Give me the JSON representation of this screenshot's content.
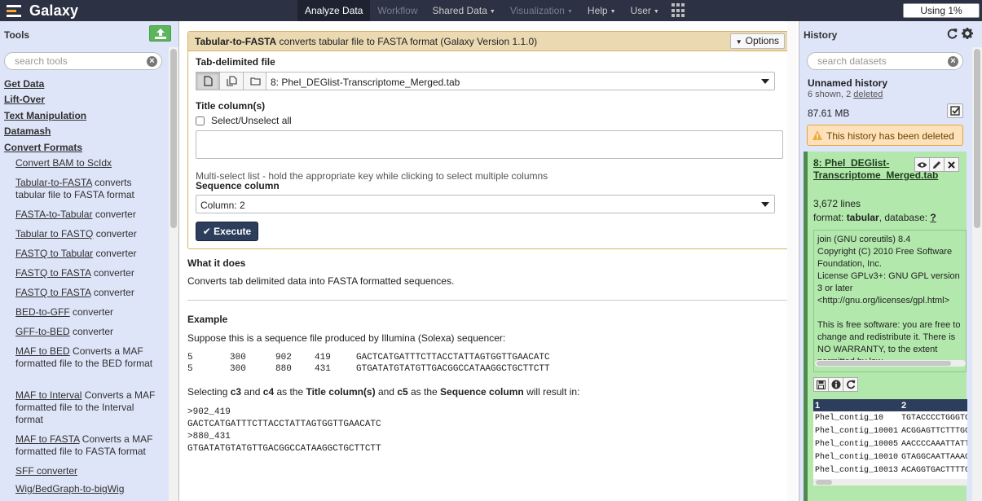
{
  "masthead": {
    "brand": "Galaxy",
    "nav": [
      {
        "label": "Analyze Data",
        "state": "active",
        "caret": false
      },
      {
        "label": "Workflow",
        "state": "disabled",
        "caret": false
      },
      {
        "label": "Shared Data",
        "state": "normal",
        "caret": true
      },
      {
        "label": "Visualization",
        "state": "disabled",
        "caret": true
      },
      {
        "label": "Help",
        "state": "normal",
        "caret": true
      },
      {
        "label": "User",
        "state": "normal",
        "caret": true
      }
    ],
    "usage": "Using 1%"
  },
  "tools_panel": {
    "title": "Tools",
    "search_placeholder": "search tools",
    "sections": [
      "Get Data",
      "Lift-Over",
      "Text Manipulation",
      "Datamash",
      "Convert Formats"
    ],
    "tools": [
      {
        "name": "Convert BAM to ScIdx",
        "desc": ""
      },
      {
        "name": "Tabular-to-FASTA",
        "desc": " converts tabular file to FASTA format"
      },
      {
        "name": "FASTA-to-Tabular",
        "desc": " converter"
      },
      {
        "name": "Tabular to FASTQ",
        "desc": " converter"
      },
      {
        "name": "FASTQ to Tabular",
        "desc": " converter"
      },
      {
        "name": "FASTQ to FASTA",
        "desc": " converter"
      },
      {
        "name": "FASTQ to FASTA",
        "desc": " converter"
      },
      {
        "name": "BED-to-GFF",
        "desc": " converter"
      },
      {
        "name": "GFF-to-BED",
        "desc": " converter"
      },
      {
        "name": "MAF to BED",
        "desc": " Converts a MAF formatted file to the BED format"
      },
      {
        "name": "MAF to Interval",
        "desc": " Converts a MAF formatted file to the Interval format"
      },
      {
        "name": "MAF to FASTA",
        "desc": " Converts a MAF formatted file to FASTA format"
      },
      {
        "name": "SFF converter",
        "desc": ""
      },
      {
        "name": "Wig/BedGraph-to-bigWig",
        "desc": ""
      }
    ]
  },
  "tool_form": {
    "title_bold": "Tabular-to-FASTA",
    "title_rest": " converts tabular file to FASTA format (Galaxy Version 1.1.0)",
    "options_label": "Options",
    "input_label": "Tab-delimited file",
    "input_value": "8: Phel_DEGlist-Transcriptome_Merged.tab",
    "title_cols_label": "Title column(s)",
    "select_all_label": "Select/Unselect all",
    "multi_help": "Multi-select list - hold the appropriate key while clicking to select multiple columns",
    "seq_col_label": "Sequence column",
    "seq_col_value": "Column: 2",
    "execute_label": "Execute"
  },
  "help": {
    "what_heading": "What it does",
    "what_text": "Converts tab delimited data into FASTA formatted sequences.",
    "example_heading": "Example",
    "example_intro": "Suppose this is a sequence file produced by Illumina (Solexa) sequencer:",
    "example_rows": [
      [
        "5",
        "300",
        "902",
        "419",
        "GACTCATGATTTCTTACCTATTAGTGGTTGAACATC"
      ],
      [
        "5",
        "300",
        "880",
        "431",
        "GTGATATGTATGTTGACGGCCATAAGGCTGCTTCTT"
      ]
    ],
    "result_parts": [
      "Selecting ",
      "c3",
      " and ",
      "c4",
      " as the ",
      "Title column(s)",
      " and ",
      "c5",
      " as the ",
      "Sequence column",
      " will result in:"
    ],
    "result_lines": [
      ">902_419",
      "GACTCATGATTTCTTACCTATTAGTGGTTGAACATC",
      ">880_431",
      "GTGATATGTATGTTGACGGCCATAAGGCTGCTTCTT"
    ]
  },
  "history_panel": {
    "title": "History",
    "search_placeholder": "search datasets",
    "name": "Unnamed history",
    "shown_text": "6 shown, 2 ",
    "deleted_link": "deleted",
    "size": "87.61 MB",
    "warning": "This history has been deleted",
    "dataset": {
      "title": "8: Phel_DEGlist-Transcriptome_Merged.tab",
      "lines": "3,672 lines",
      "format_label": "format: ",
      "format_value": "tabular",
      "db_label": ", database: ",
      "db_value": "?",
      "info": "join (GNU coreutils) 8.4\nCopyright (C) 2010 Free Software Foundation, Inc.\nLicense GPLv3+: GNU GPL version 3 or later <http://gnu.org/licenses/gpl.html>\n\nThis is free software: you are free to change and redistribute it. There is NO WARRANTY, to the extent permitted by law.",
      "peek_headers": [
        "1",
        "2"
      ],
      "peek_rows": [
        [
          "Phel_contig_10",
          "TGTACCCCTGGGTGGAC"
        ],
        [
          "Phel_contig_10001",
          "ACGGAGTTCTTTGCCCC"
        ],
        [
          "Phel_contig_10005",
          "AACCCCAAATTATTTAA"
        ],
        [
          "Phel_contig_10010",
          "GTAGGCAATTAAACCAA"
        ],
        [
          "Phel_contig_10013",
          "ACAGGTGACTTTTGTTC"
        ]
      ]
    }
  },
  "colors": {
    "masthead": "#2c3143",
    "panel_bg": "#dfe5f9",
    "form_header": "#ebd9b2",
    "dataset_ok": "#b2e8ac",
    "execute": "#2c3e5b",
    "warning_bg": "#fce1ba"
  }
}
